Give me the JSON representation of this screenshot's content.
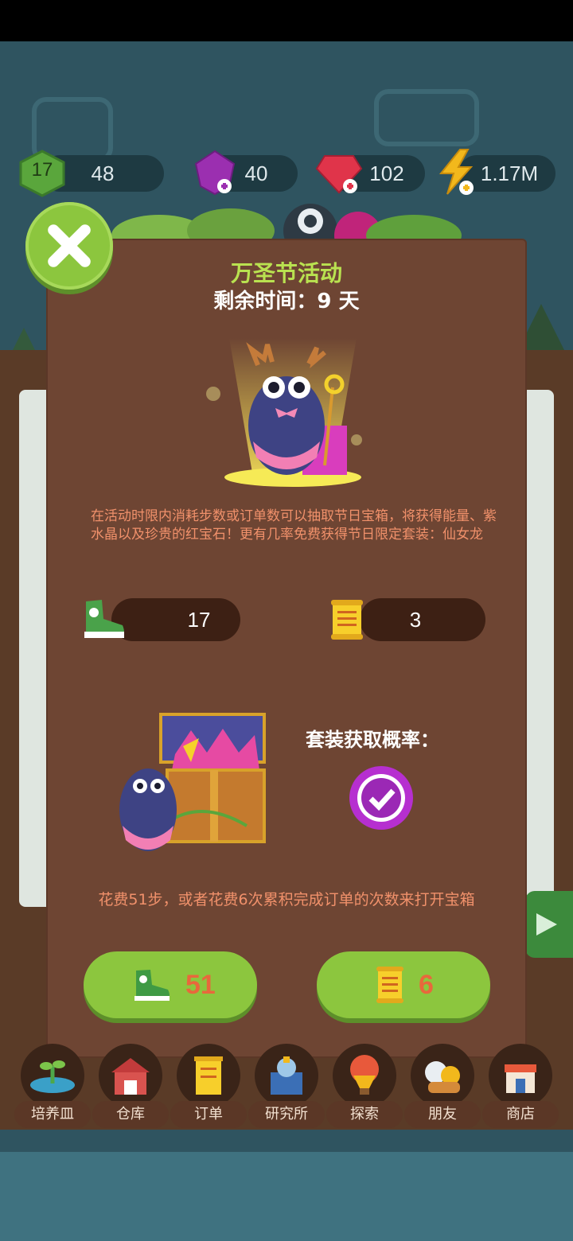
{
  "resources": {
    "level": "17",
    "level_progress": "48",
    "gems": "40",
    "rubies": "102",
    "energy": "1.17M"
  },
  "panel": {
    "title": "万圣节活动",
    "remaining_time": "剩余时间：9 天",
    "description": "在活动时限内消耗步数或订单数可以抽取节日宝箱，将获得能量、紫水晶以及珍贵的红宝石！更有几率免费获得节日限定套装：仙女龙",
    "steps_count": "17",
    "orders_count": "3",
    "probability_label": "套装获取概率：",
    "cost_text": "花费51步，或者花费6次累积完成订单的次数来打开宝箱",
    "steps_button_value": "51",
    "orders_button_value": "6"
  },
  "nav": [
    {
      "label": "培养皿",
      "icon": "petri-dish-icon"
    },
    {
      "label": "仓库",
      "icon": "warehouse-icon"
    },
    {
      "label": "订单",
      "icon": "order-scroll-icon"
    },
    {
      "label": "研究所",
      "icon": "lab-icon"
    },
    {
      "label": "探索",
      "icon": "balloon-icon"
    },
    {
      "label": "朋友",
      "icon": "friends-icon"
    },
    {
      "label": "商店",
      "icon": "shop-icon"
    }
  ],
  "colors": {
    "panel_bg": "#6e4533",
    "accent_green": "#8cc63e",
    "title_green": "#b9e250",
    "desc_orange": "#f1916b"
  }
}
